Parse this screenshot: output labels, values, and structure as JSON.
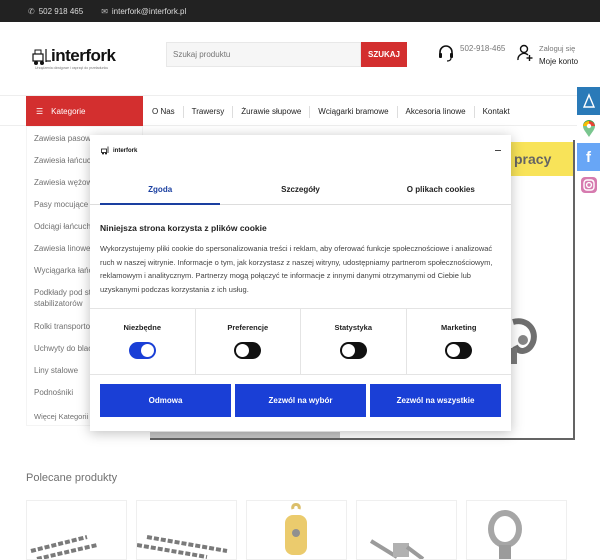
{
  "topbar": {
    "phone": "502 918 465",
    "email": "interfork@interfork.pl"
  },
  "logo": {
    "brand": "interfork",
    "tagline": "Urządzenia dźwigowe i osprzęt do przeładunku"
  },
  "search": {
    "placeholder": "Szukaj produktu",
    "button": "SZUKAJ"
  },
  "contact": {
    "phone": "502-918-465"
  },
  "account": {
    "line1": "Zaloguj się",
    "line2": "Moje konto"
  },
  "nav": {
    "categories_label": "Kategorie",
    "links": [
      "O Nas",
      "Trawersy",
      "Żurawie słupowe",
      "Wciągarki bramowe",
      "Akcesoria linowe",
      "Kontakt"
    ]
  },
  "categories": [
    "Zawiesia pasowe",
    "Zawiesia łańcuchowe",
    "Zawiesia wężowe",
    "Pasy mocujące",
    "Odciągi łańcuchowe",
    "Zawiesia linowe",
    "Wyciągarka łańcuchowa",
    "Podkłady pod stopy",
    "stabilizatorów",
    "Rolki transportowe",
    "Uchwyty do blach",
    "Liny stalowe",
    "Podnośniki",
    "Więcej Kategorii"
  ],
  "banner": {
    "text": "pracy"
  },
  "recommended": {
    "title": "Polecane produkty"
  },
  "cookie": {
    "logo": "interfork",
    "tabs": [
      "Zgoda",
      "Szczegóły",
      "O plikach cookies"
    ],
    "title": "Niniejsza strona korzysta z plików cookie",
    "text": "Wykorzystujemy pliki cookie do spersonalizowania treści i reklam, aby oferować funkcje społecznościowe i analizować ruch w naszej witrynie. Informacje o tym, jak korzystasz z naszej witryny, udostępniamy partnerom społecznościowym, reklamowym i analitycznym. Partnerzy mogą połączyć te informacje z innymi danymi otrzymanymi od Ciebie lub uzyskanymi podczas korzystania z ich usług.",
    "switches": [
      {
        "label": "Niezbędne",
        "on": true
      },
      {
        "label": "Preferencje",
        "on": false
      },
      {
        "label": "Statystyka",
        "on": false
      },
      {
        "label": "Marketing",
        "on": false
      }
    ],
    "buttons": {
      "deny": "Odmowa",
      "allow_selection": "Zezwól na wybór",
      "allow_all": "Zezwól na wszystkie"
    }
  },
  "colors": {
    "accent": "#d32f2f",
    "cookie_blue": "#1a3fd6",
    "banner_yellow": "#f5d400"
  }
}
